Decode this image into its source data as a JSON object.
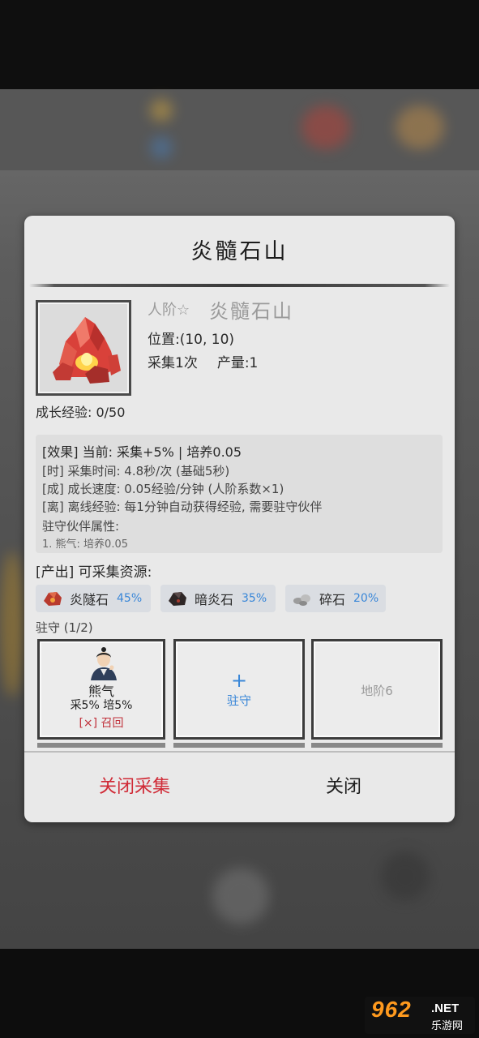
{
  "dialog": {
    "title": "炎髓石山",
    "rank": "人阶☆",
    "item_name": "炎髓石山",
    "position_label": "位置:(10, 10)",
    "gather_count": "采集1次",
    "output": "产量:1",
    "growth_exp": "成长经验: 0/50",
    "effects": {
      "main": "[效果] 当前: 采集+5% | 培养0.05",
      "time": "[时] 采集时间: 4.8秒/次 (基础5秒)",
      "grow": "[成] 成长速度: 0.05经验/分钟 (人阶系数×1)",
      "offline": "[离] 离线经验: 每1分钟自动获得经验, 需要驻守伙伴",
      "partner_attr_title": "驻守伙伴属性:",
      "partner_attr_1": "1. 熊气: 培养0.05"
    },
    "produce_label": "[产出] 可采集资源:",
    "resources": [
      {
        "name": "炎隧石",
        "percent": "45%",
        "icon": "red-ore-icon"
      },
      {
        "name": "暗炎石",
        "percent": "35%",
        "icon": "dark-ore-icon"
      },
      {
        "name": "碎石",
        "percent": "20%",
        "icon": "gravel-icon"
      }
    ],
    "guard_label": "驻守 (1/2)",
    "slots": {
      "hero_name": "熊气",
      "hero_stats": "采5% 培5%",
      "recall": "[×] 召回",
      "plus": "+",
      "station": "驻守",
      "locked": "地阶6"
    },
    "buttons": {
      "close_gather": "关闭采集",
      "close": "关闭"
    }
  },
  "watermark": {
    "number": "962",
    "net": ".NET",
    "sub": "乐游网"
  },
  "colors": {
    "accent_blue": "#3a87d8",
    "danger_red": "#d02a36"
  }
}
